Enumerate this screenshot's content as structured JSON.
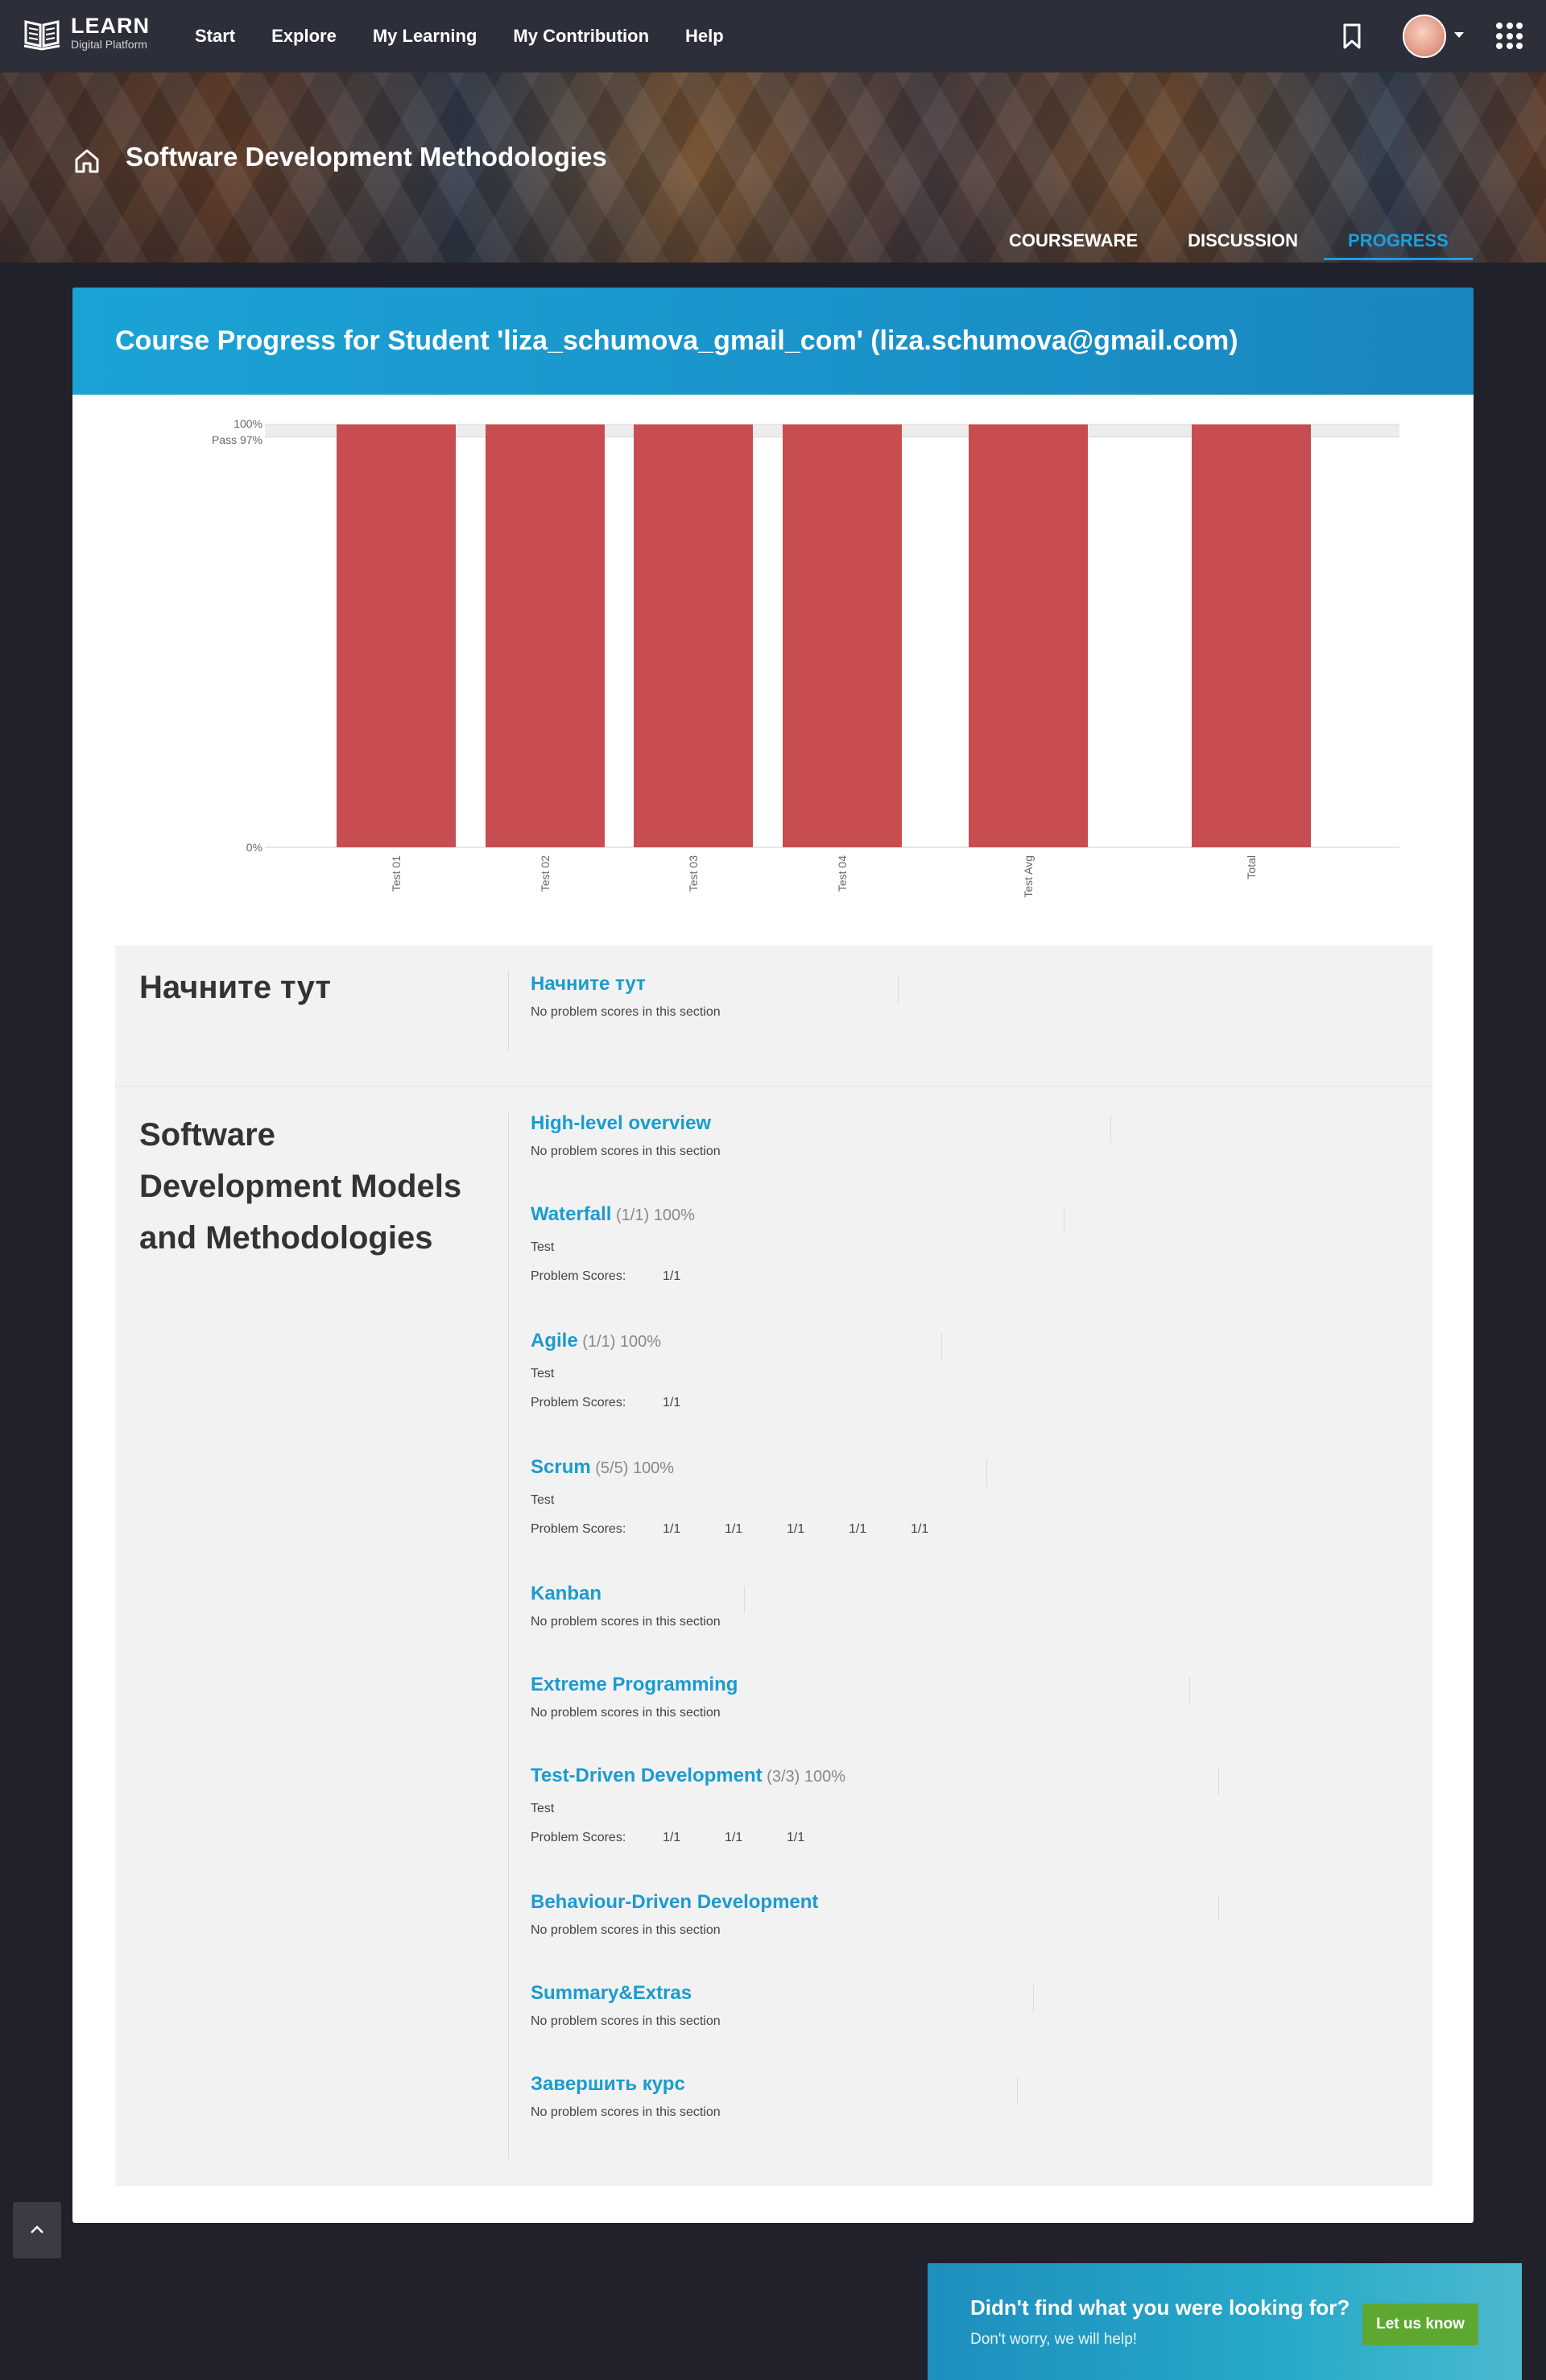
{
  "nav": {
    "logo_title": "LEARN",
    "logo_subtitle": "Digital Platform",
    "links": [
      "Start",
      "Explore",
      "My Learning",
      "My Contribution",
      "Help"
    ]
  },
  "course": {
    "title": "Software Development Methodologies",
    "tabs": [
      "COURSEWARE",
      "DISCUSSION",
      "PROGRESS"
    ],
    "active_tab": "PROGRESS"
  },
  "progress": {
    "heading": "Course Progress for Student 'liza_schumova_gmail_com' (liza.schumova@gmail.com)"
  },
  "chart_data": {
    "type": "bar",
    "categories": [
      "Test 01",
      "Test 02",
      "Test 03",
      "Test 04",
      "Test Avg",
      "Total"
    ],
    "values": [
      100,
      100,
      100,
      100,
      100,
      100
    ],
    "ylim": [
      0,
      100
    ],
    "y_tick_labels": [
      "0%",
      "100%"
    ],
    "pass_label": "Pass 97%",
    "pass_value": 97,
    "bar_color": "#c84d51",
    "grid": false
  },
  "sections": [
    {
      "title": "Начните тут",
      "subsections": [
        {
          "title": "Начните тут",
          "meta": "",
          "note": "No problem scores in this section"
        }
      ]
    },
    {
      "title": "Software Development Models and Methodologies",
      "subsections": [
        {
          "title": "High-level overview",
          "meta": "",
          "note": "No problem scores in this section"
        },
        {
          "title": "Waterfall",
          "meta": "(1/1) 100%",
          "label": "Test",
          "scores_label": "Problem Scores:",
          "scores": [
            "1/1"
          ]
        },
        {
          "title": "Agile",
          "meta": "(1/1) 100%",
          "label": "Test",
          "scores_label": "Problem Scores:",
          "scores": [
            "1/1"
          ]
        },
        {
          "title": "Scrum",
          "meta": "(5/5) 100%",
          "label": "Test",
          "scores_label": "Problem Scores:",
          "scores": [
            "1/1",
            "1/1",
            "1/1",
            "1/1",
            "1/1"
          ]
        },
        {
          "title": "Kanban",
          "meta": "",
          "note": "No problem scores in this section"
        },
        {
          "title": "Extreme Programming",
          "meta": "",
          "note": "No problem scores in this section"
        },
        {
          "title": "Test-Driven Development",
          "meta": "(3/3) 100%",
          "label": "Test",
          "scores_label": "Problem Scores:",
          "scores": [
            "1/1",
            "1/1",
            "1/1"
          ]
        },
        {
          "title": "Behaviour-Driven Development",
          "meta": "",
          "note": "No problem scores in this section"
        },
        {
          "title": "Summary&Extras",
          "meta": "",
          "note": "No problem scores in this section"
        },
        {
          "title": "Завершить курс",
          "meta": "",
          "note": "No problem scores in this section"
        }
      ]
    }
  ],
  "help_banner": {
    "question": "Didn't find what you were looking for?",
    "subtext": "Don't worry, we will help!",
    "button": "Let us know"
  },
  "icons": {
    "logo": "book-icon",
    "bookmark": "bookmark-icon",
    "avatar": "avatar",
    "apps": "apps-grid-icon",
    "home": "home-icon",
    "to_top": "chevron-up-icon"
  }
}
